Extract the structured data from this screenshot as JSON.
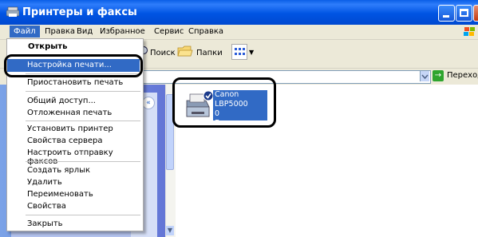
{
  "window": {
    "title": "Принтеры и факсы"
  },
  "menubar": {
    "items": [
      "Файл",
      "Правка",
      "Вид",
      "Избранное",
      "Сервис",
      "Справка"
    ]
  },
  "toolbar": {
    "search_label": "Поиск",
    "folders_label": "Папки"
  },
  "addressbar": {
    "go_label": "Переход"
  },
  "file_menu": {
    "open": "Открыть",
    "print_settings": "Настройка печати...",
    "pause_printing": "Приостановить печать",
    "sharing": "Общий доступ...",
    "deferred_printing": "Отложенная печать",
    "install_printer": "Установить принтер",
    "server_properties": "Свойства сервера",
    "setup_fax": "Настроить отправку факсов",
    "create_shortcut": "Создать ярлык",
    "delete": "Удалить",
    "rename": "Переименовать",
    "properties": "Свойства",
    "close": "Закрыть"
  },
  "printer": {
    "name": "Canon LBP5000",
    "jobs": "0",
    "status": "Готов"
  },
  "colors": {
    "title_blue": "#0054e3",
    "selection_blue": "#316ac5",
    "menu_bg": "#ece9d8"
  },
  "icons": [
    "printer-icon",
    "search-icon",
    "folders-icon",
    "views-icon",
    "go-icon",
    "collapse-icon"
  ]
}
